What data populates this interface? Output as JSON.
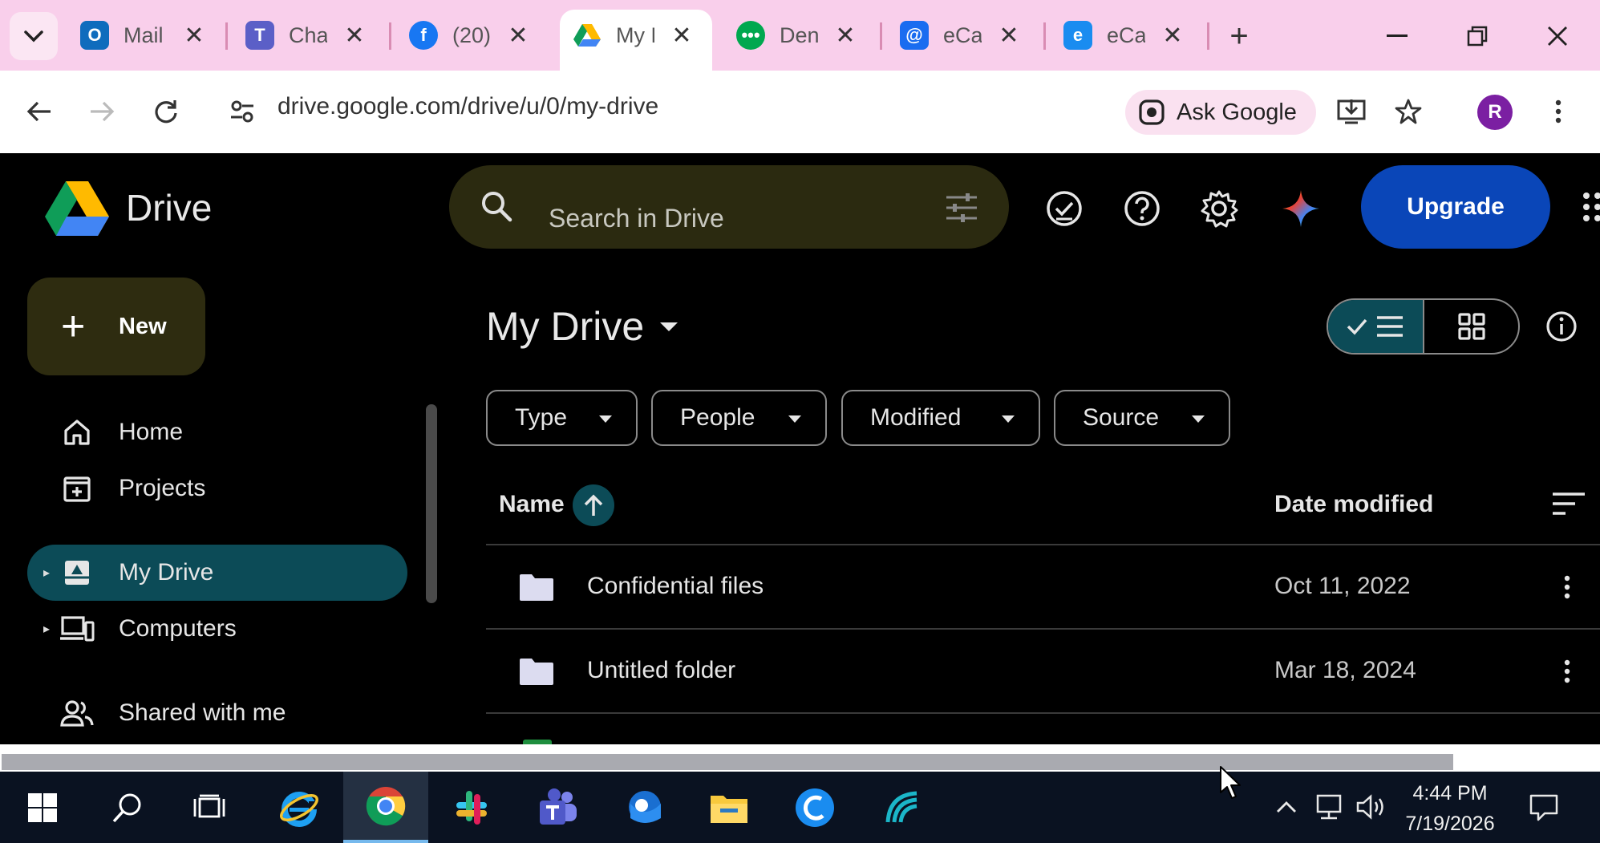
{
  "browser": {
    "tabs": [
      {
        "title": "Mail",
        "icon": "outlook-icon",
        "color": "#0f6cbd"
      },
      {
        "title": "Chat",
        "icon": "teams-icon",
        "color": "#5b5fc7"
      },
      {
        "title": "(20)",
        "icon": "facebook-icon",
        "color": "#1877f2"
      },
      {
        "title": "My D",
        "icon": "google-drive-icon",
        "color": "#1e8e3e",
        "active": true
      },
      {
        "title": "Den",
        "icon": "chat-bubble-icon",
        "color": "#00a84f"
      },
      {
        "title": "eCa",
        "icon": "messenger-icon",
        "color": "#1a6cf0"
      },
      {
        "title": "eCa",
        "icon": "ecal-icon",
        "color": "#1a8cf0"
      }
    ],
    "url": "drive.google.com/drive/u/0/my-drive",
    "ask_google": "Ask Google",
    "profile_initial": "R"
  },
  "drive": {
    "app_name": "Drive",
    "search_placeholder": "Search in Drive",
    "upgrade_label": "Upgrade",
    "new_label": "New",
    "sidebar": [
      {
        "label": "Home",
        "icon": "home-icon"
      },
      {
        "label": "Projects",
        "icon": "projects-icon"
      },
      {
        "label": "My Drive",
        "icon": "my-drive-icon",
        "active": true,
        "expandable": true
      },
      {
        "label": "Computers",
        "icon": "computers-icon",
        "expandable": true
      },
      {
        "label": "Shared with me",
        "icon": "shared-icon"
      }
    ],
    "page_title": "My Drive",
    "filters": [
      "Type",
      "People",
      "Modified",
      "Source"
    ],
    "columns": {
      "name": "Name",
      "date": "Date modified"
    },
    "files": [
      {
        "name": "Confidential files",
        "date": "Oct 11, 2022",
        "type": "folder"
      },
      {
        "name": "Untitled folder",
        "date": "Mar 18, 2024",
        "type": "folder"
      }
    ]
  },
  "taskbar": {
    "time": "4:44 PM",
    "date": "7/19/2026",
    "apps": [
      "start-icon",
      "search-icon",
      "task-view-icon",
      "internet-explorer-icon",
      "chrome-icon",
      "slack-icon",
      "teams-icon",
      "outlook-icon",
      "file-explorer-icon",
      "ecal-icon",
      "feather-app-icon"
    ]
  }
}
